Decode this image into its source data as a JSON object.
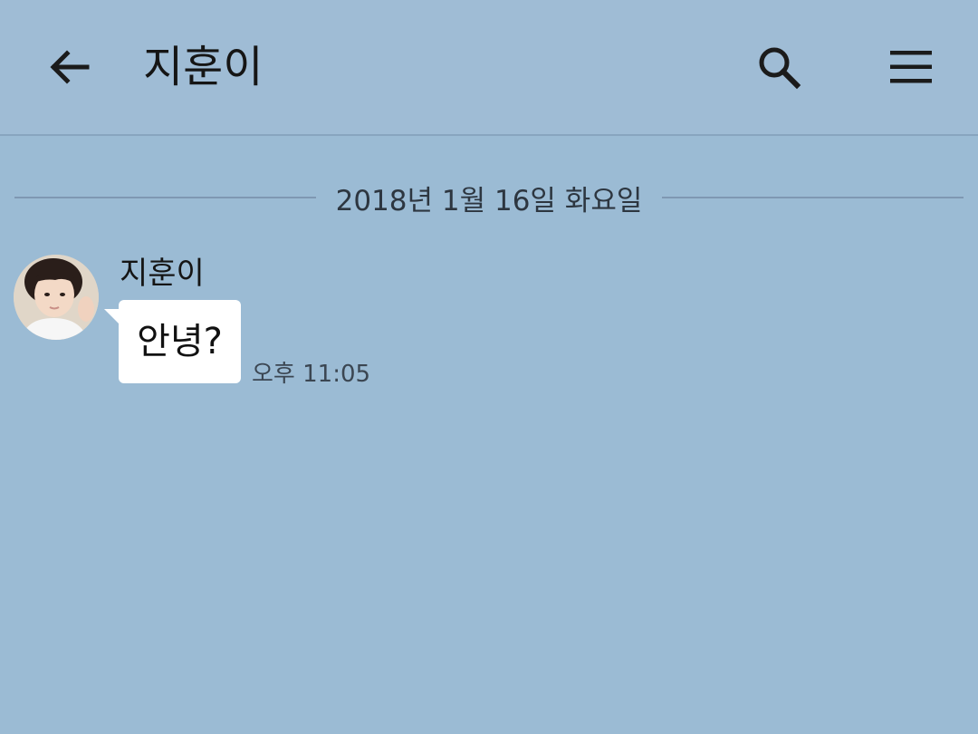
{
  "header": {
    "back_icon": "arrow-left-icon",
    "title": "지훈이",
    "search_icon": "search-icon",
    "menu_icon": "hamburger-menu-icon"
  },
  "chat": {
    "date_divider": "2018년 1월 16일 화요일",
    "messages": [
      {
        "sender": "지훈이",
        "avatar": "profile-photo",
        "text": "안녕?",
        "time": "오후 11:05"
      }
    ]
  },
  "colors": {
    "background": "#9bbbd4",
    "bubble": "#ffffff",
    "divider": "#7f98b2"
  }
}
